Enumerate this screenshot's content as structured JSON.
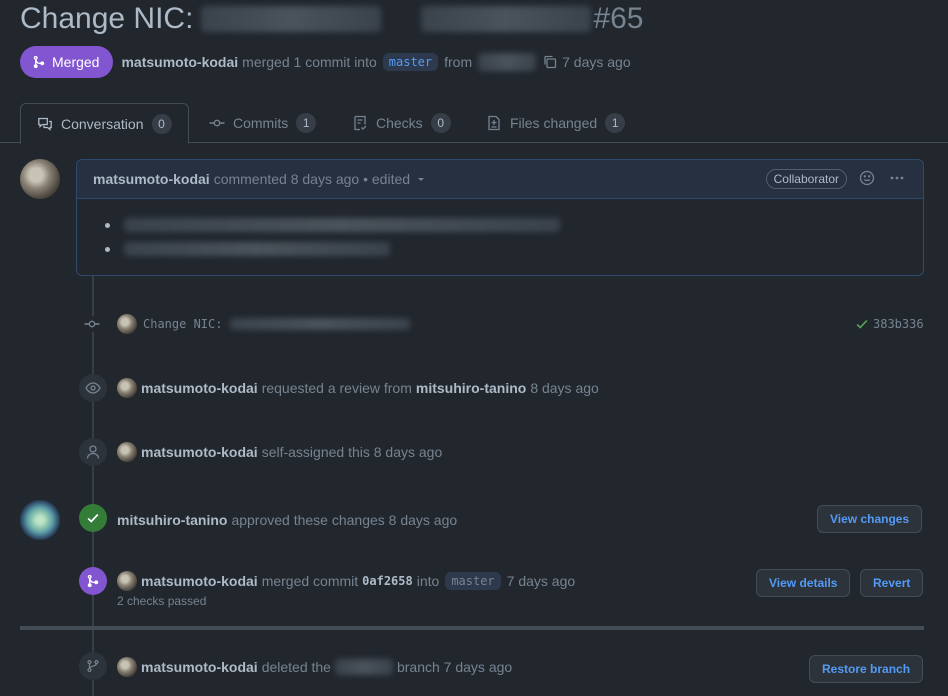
{
  "title": {
    "prefix": "Change NIC:",
    "number": "#65"
  },
  "meta": {
    "status": "Merged",
    "author": "matsumoto-kodai",
    "action": "merged 1 commit into",
    "base_branch": "master",
    "from": "from",
    "time": "7 days ago"
  },
  "tabs": [
    {
      "label": "Conversation",
      "count": "0"
    },
    {
      "label": "Commits",
      "count": "1"
    },
    {
      "label": "Checks",
      "count": "0"
    },
    {
      "label": "Files changed",
      "count": "1"
    }
  ],
  "comment": {
    "author": "matsumoto-kodai",
    "meta": "commented 8 days ago • edited",
    "role": "Collaborator"
  },
  "commit": {
    "message": "Change NIC:",
    "sha": "383b336"
  },
  "events": {
    "review": {
      "actor": "matsumoto-kodai",
      "text": "requested a review from",
      "reviewer": "mitsuhiro-tanino",
      "time": "8 days ago"
    },
    "assign": {
      "actor": "matsumoto-kodai",
      "text": "self-assigned this 8 days ago"
    },
    "approve": {
      "actor": "mitsuhiro-tanino",
      "text": "approved these changes 8 days ago",
      "button": "View changes"
    },
    "merge": {
      "actor": "matsumoto-kodai",
      "text": "merged commit",
      "sha": "0af2658",
      "into": "into",
      "branch": "master",
      "time": "7 days ago",
      "checks": "2 checks passed",
      "details_button": "View details",
      "revert_button": "Revert"
    },
    "delete": {
      "actor": "matsumoto-kodai",
      "text": "deleted the",
      "after": "branch 7 days ago",
      "button": "Restore branch"
    }
  },
  "colors": {
    "merged": "#8256d0",
    "approved": "#347d39",
    "link": "#539bf5"
  }
}
